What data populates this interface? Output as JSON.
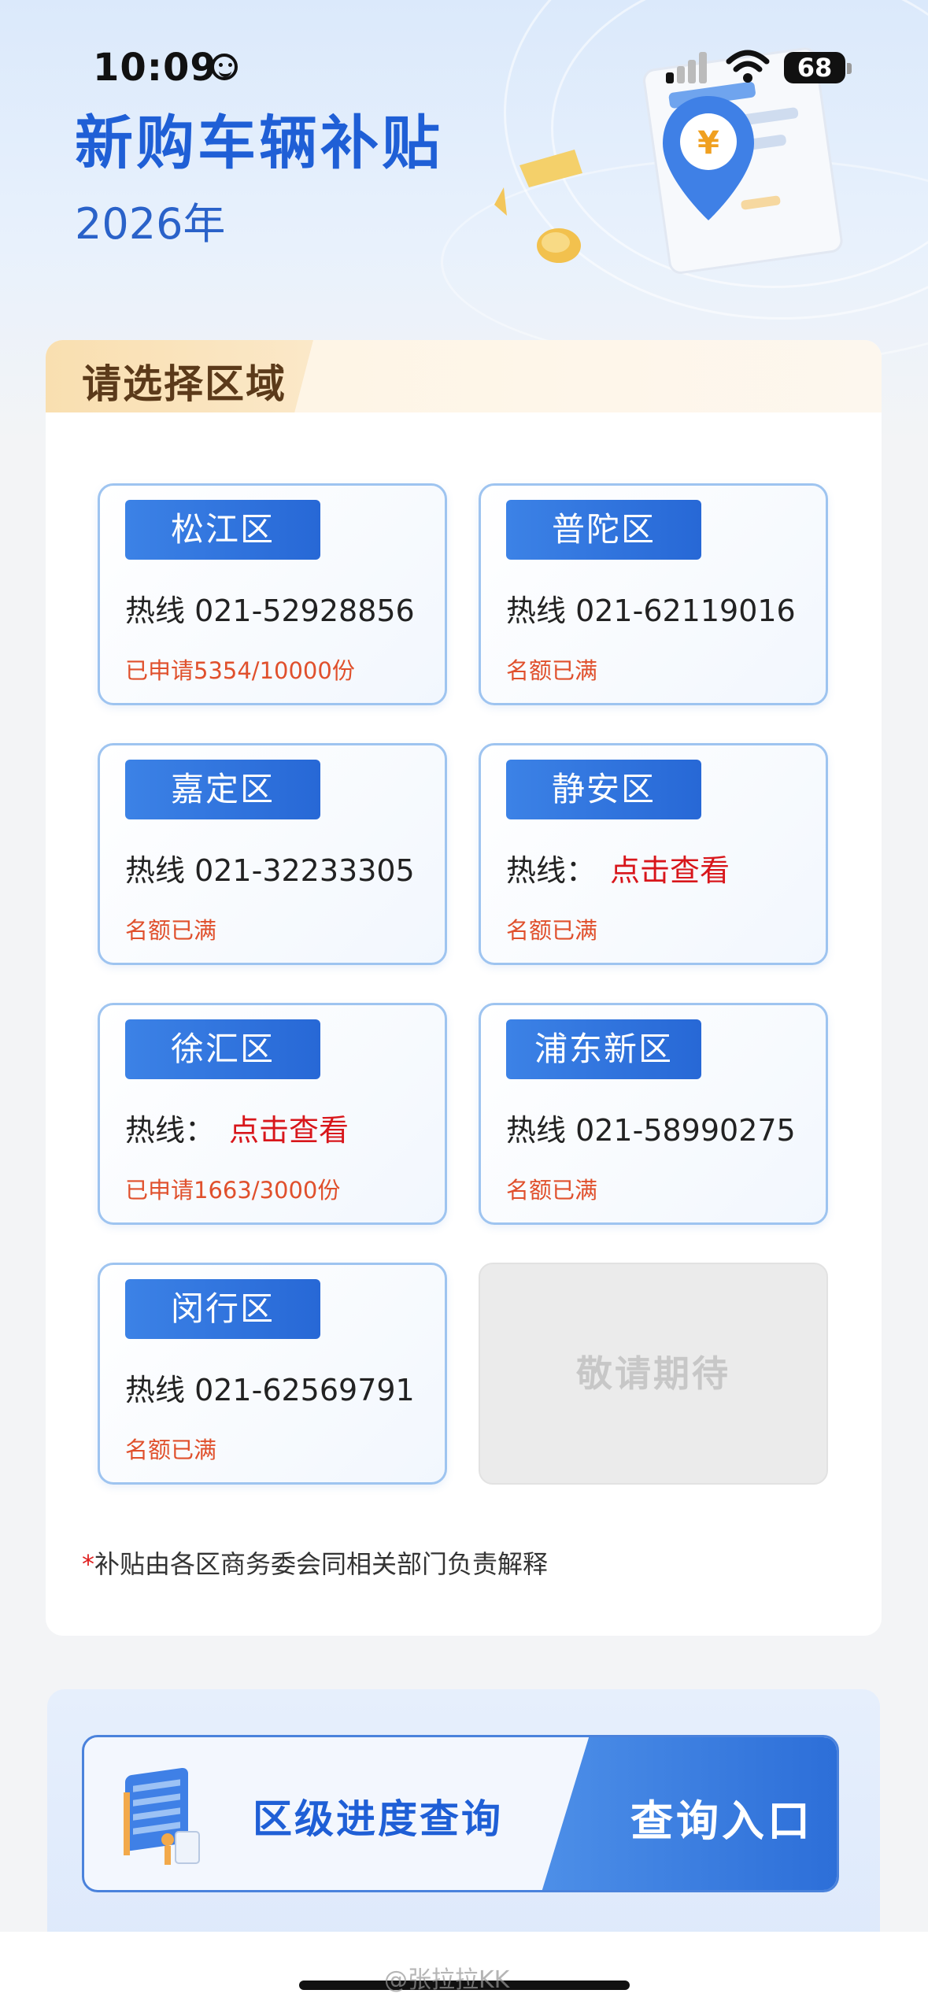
{
  "status_bar": {
    "time": "10:09",
    "battery": "68"
  },
  "header": {
    "title": "新购车辆补贴",
    "year": "2026年"
  },
  "region_panel": {
    "title": "请选择区域",
    "cards": [
      {
        "name": "松江区",
        "hotline": "热线 021-52928856",
        "status": "已申请5354/10000份"
      },
      {
        "name": "普陀区",
        "hotline": "热线 021-62119016",
        "status": "名额已满"
      },
      {
        "name": "嘉定区",
        "hotline": "热线 021-32233305",
        "status": "名额已满"
      },
      {
        "name": "静安区",
        "hotline_label": "热线：",
        "hotline_link": "点击查看",
        "status": "名额已满"
      },
      {
        "name": "徐汇区",
        "hotline_label": "热线：",
        "hotline_link": "点击查看",
        "status": "已申请1663/3000份"
      },
      {
        "name": "浦东新区",
        "hotline": "热线 021-58990275",
        "status": "名额已满"
      },
      {
        "name": "闵行区",
        "hotline": "热线 021-62569791",
        "status": "名额已满"
      }
    ],
    "coming_soon": "敬请期待",
    "footnote_mark": "*",
    "footnote": "补贴由各区商务委会同相关部门负责解释"
  },
  "query": {
    "label": "区级进度查询",
    "entry_button": "查询入口"
  },
  "watermark": "@张拉拉KK",
  "colors": {
    "brand_blue": "#2768d6",
    "status_red": "#e0502c",
    "link_red": "#d8161b",
    "header_gold": "#f9dfb0"
  }
}
